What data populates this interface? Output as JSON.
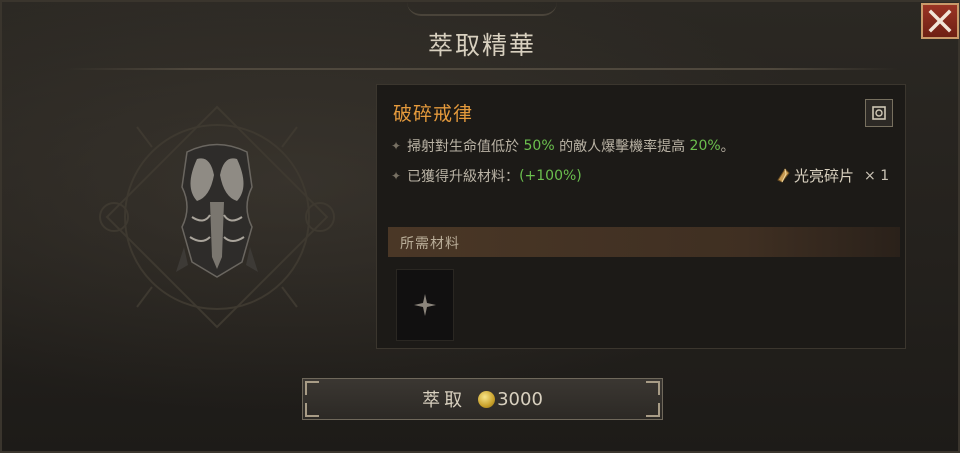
{
  "window": {
    "title": "萃取精華",
    "close_icon": "close-x-icon"
  },
  "aspect": {
    "name": "破碎戒律",
    "codex_icon": "codex-scroll-icon",
    "effect": {
      "prefix": "掃射對生命值低於",
      "value1": "50%",
      "middle": "的敵人爆擊機率提高",
      "value2": "20%",
      "suffix": "。"
    },
    "upgrade": {
      "label": "已獲得升級材料：",
      "value": "(+100%)"
    },
    "reward": {
      "icon": "shard-icon",
      "name": "光亮碎片",
      "quantity": "× 1"
    }
  },
  "requirements": {
    "header": "所需材料",
    "slot_icon": "cross-icon"
  },
  "extract_button": {
    "label": "萃取",
    "currency_icon": "gold-coin-icon",
    "cost": "3000"
  },
  "colors": {
    "aspect_name": "#e49a3c",
    "highlight_value": "#6bbf4e",
    "close_button": "#8a2a1c"
  }
}
